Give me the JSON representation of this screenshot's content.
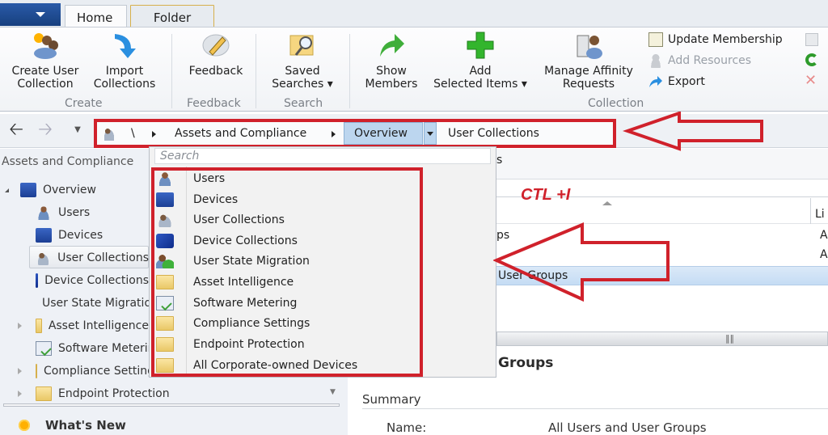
{
  "ribbon": {
    "tabs": [
      {
        "label": "Home",
        "active": true
      },
      {
        "label": "Folder",
        "active": false
      }
    ],
    "groups": [
      {
        "label": "Create",
        "buttons": [
          "Create User\nCollection",
          "Import\nCollections"
        ]
      },
      {
        "label": "Feedback",
        "buttons": [
          "Feedback"
        ]
      },
      {
        "label": "Search",
        "buttons": [
          "Saved\nSearches"
        ]
      },
      {
        "label": "Collection",
        "buttons": [
          "Show\nMembers",
          "Add\nSelected Items",
          "Manage Affinity\nRequests"
        ]
      }
    ],
    "create_user_collection_line1": "Create User",
    "create_user_collection_line2": "Collection",
    "import_line1": "Import",
    "import_line2": "Collections",
    "feedback": "Feedback",
    "saved_line1": "Saved",
    "saved_line2": "Searches",
    "show_line1": "Show",
    "show_line2": "Members",
    "add_line1": "Add",
    "add_line2": "Selected Items",
    "manage_line1": "Manage Affinity",
    "manage_line2": "Requests",
    "group_create": "Create",
    "group_feedback": "Feedback",
    "group_search": "Search",
    "group_collection": "Collection",
    "small_buttons": {
      "update_membership": "Update Membership",
      "add_resources": "Add Resources",
      "export": "Export"
    }
  },
  "nav": {
    "root": "\\",
    "crumb1": "Assets and Compliance",
    "crumb2": "Overview",
    "crumb3": "User Collections"
  },
  "annotation": {
    "shortcut": "CTL +I"
  },
  "sidebar": {
    "title": "Assets and Compliance",
    "items": [
      {
        "label": "Overview"
      },
      {
        "label": "Users"
      },
      {
        "label": "Devices"
      },
      {
        "label": "User Collections"
      },
      {
        "label": "Device Collections"
      },
      {
        "label": "User State Migration"
      },
      {
        "label": "Asset Intelligence"
      },
      {
        "label": "Software Metering"
      },
      {
        "label": "Compliance Settings"
      },
      {
        "label": "Endpoint Protection"
      }
    ],
    "whats_new": "What's New"
  },
  "dropdown": {
    "search_placeholder": "Search",
    "items": [
      {
        "label": "Users",
        "icon": "user-icon"
      },
      {
        "label": "Devices",
        "icon": "device-icon"
      },
      {
        "label": "User Collections",
        "icon": "user-collection-icon"
      },
      {
        "label": "Device Collections",
        "icon": "device-collection-icon"
      },
      {
        "label": "User State Migration",
        "icon": "user-state-migration-icon"
      },
      {
        "label": "Asset Intelligence",
        "icon": "folder-icon"
      },
      {
        "label": "Software Metering",
        "icon": "software-metering-icon"
      },
      {
        "label": "Compliance Settings",
        "icon": "folder-icon"
      },
      {
        "label": "Endpoint Protection",
        "icon": "folder-icon"
      },
      {
        "label": "All Corporate-owned Devices",
        "icon": "folder-icon"
      }
    ]
  },
  "content": {
    "header_partial": "s",
    "col_partial": "Li",
    "rows": [
      {
        "name_partial": "ps",
        "col2_partial": "A"
      },
      {
        "name_partial": "",
        "col2_partial": "A"
      },
      {
        "name_partial": "User Groups",
        "col2_partial": ""
      }
    ],
    "detail_title_partial": "Groups",
    "summary_label": "Summary",
    "name_label": "Name:",
    "name_value": "All Users and User Groups"
  }
}
